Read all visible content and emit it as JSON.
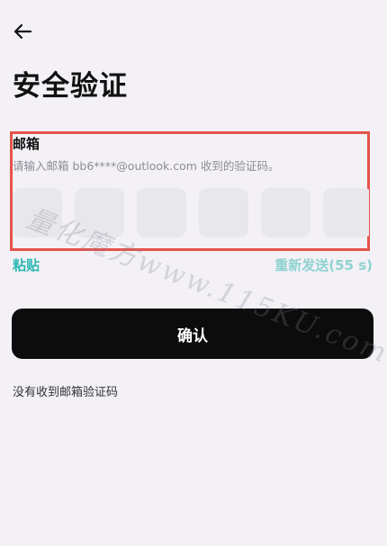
{
  "header": {
    "back_icon": "arrow-left-icon",
    "title": "安全验证"
  },
  "verification": {
    "label": "邮箱",
    "hint": "请输入邮箱 bb6****@outlook.com 收到的验证码。",
    "code_length": 6,
    "highlight_color": "#e5534b"
  },
  "actions": {
    "paste_label": "粘贴",
    "resend_label": "重新发送(55 s)",
    "confirm_label": "确认",
    "no_code_label": "没有收到邮箱验证码"
  },
  "watermark": {
    "text": "量化魔方www.115KU.com"
  },
  "colors": {
    "background": "#f3f1f6",
    "accent": "#2cb8b2",
    "accent_disabled": "#8ed2d0",
    "primary_button": "#0c0c0c",
    "code_box": "#e8e7ec"
  }
}
